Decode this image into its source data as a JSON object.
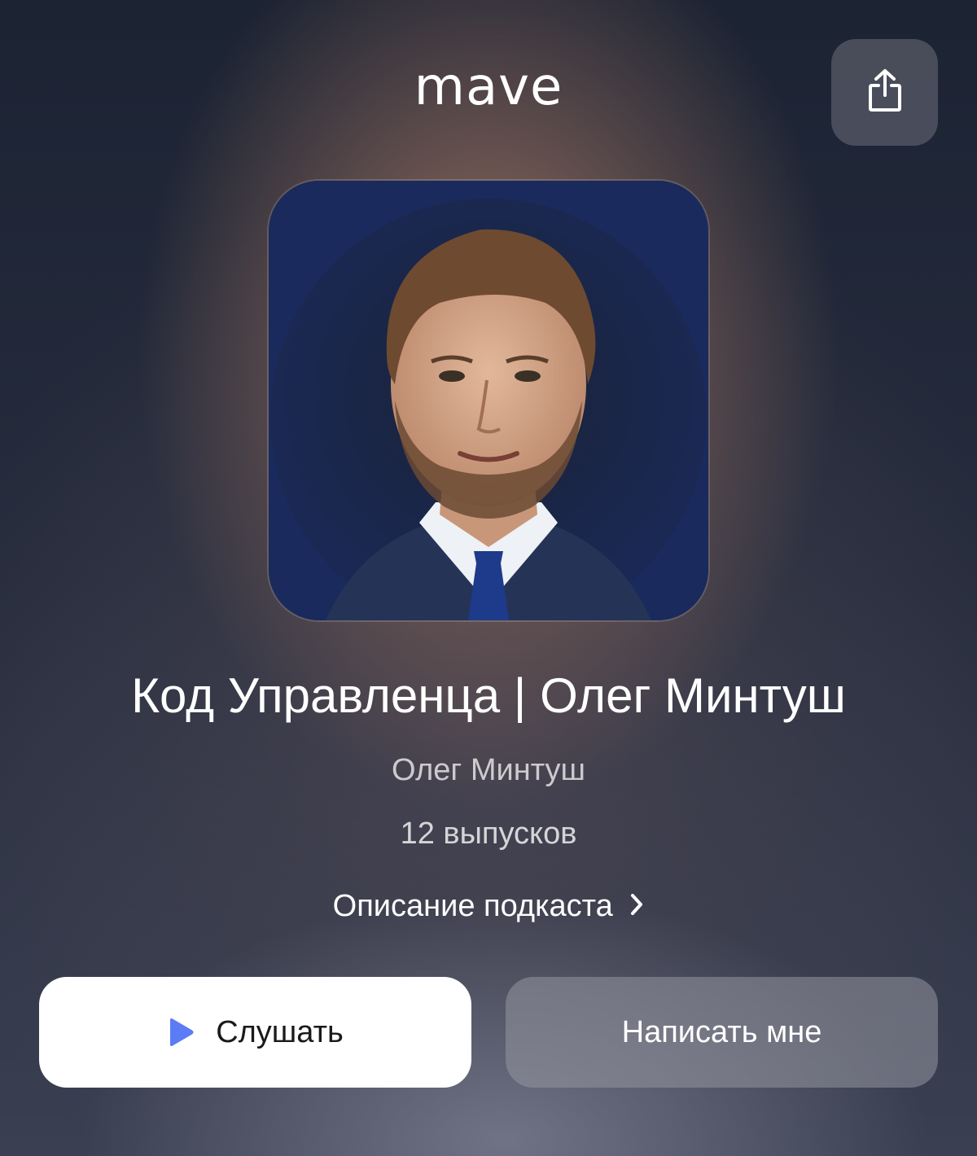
{
  "header": {
    "logo_text": "mave",
    "share_icon": "share-icon"
  },
  "podcast": {
    "title": "Код Управленца | Олег Минтуш",
    "author": "Олег Минтуш",
    "episodes": "12 выпусков",
    "description_link": "Описание подкаста"
  },
  "actions": {
    "listen_label": "Слушать",
    "write_label": "Написать мне"
  },
  "colors": {
    "accent_play": "#5b7cf5",
    "listen_bg": "#ffffff",
    "cover_bg": "#1a2450"
  }
}
